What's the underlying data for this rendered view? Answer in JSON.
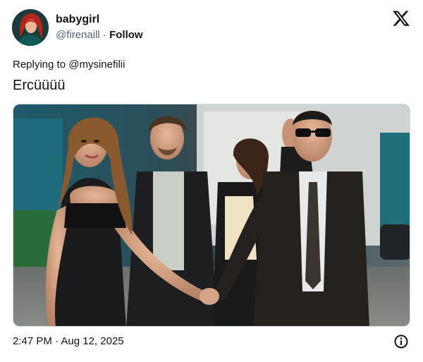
{
  "author": {
    "display_name": "babygirl",
    "handle": "@firenaill",
    "separator": "·",
    "follow_label": "Follow"
  },
  "brand": {
    "icon": "x-logo-icon"
  },
  "tweet": {
    "replying_to_prefix": "Replying to",
    "replying_to_handle": "@mysinefilii",
    "text": "Ercüüüü"
  },
  "media": {
    "type": "photo"
  },
  "meta": {
    "time": "2:47 PM",
    "separator": "·",
    "date": "Aug 12, 2025",
    "info_icon": "info-icon"
  },
  "colors": {
    "text_primary": "#0f1419",
    "text_secondary": "#536471",
    "border": "#cfd9de"
  }
}
